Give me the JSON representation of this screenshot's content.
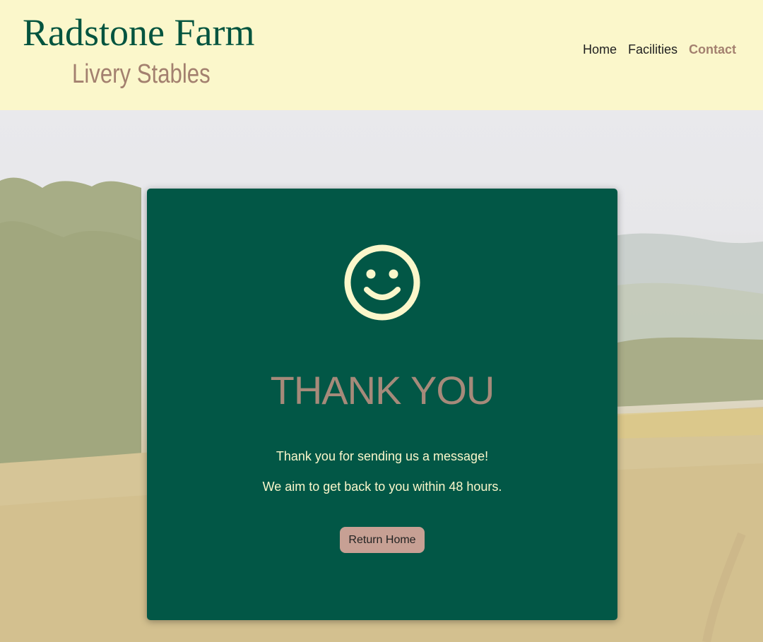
{
  "header": {
    "brand_title": "Radstone Farm",
    "brand_subtitle": "Livery Stables",
    "nav": [
      {
        "label": "Home"
      },
      {
        "label": "Facilities"
      },
      {
        "label": "Contact",
        "active": true
      }
    ]
  },
  "card": {
    "icon": "smiley-face-icon",
    "title": "THANK YOU",
    "message_1": "Thank you for sending us a message!",
    "message_2": "We aim to get back to you within 48 hours.",
    "button_label": "Return Home"
  },
  "colors": {
    "header_bg": "#fbf7cb",
    "brand_green": "#03543f",
    "accent_brown": "#a3806f",
    "card_bg": "#025746",
    "button_bg": "#c7a094",
    "cream_text": "#fbf7cb"
  }
}
